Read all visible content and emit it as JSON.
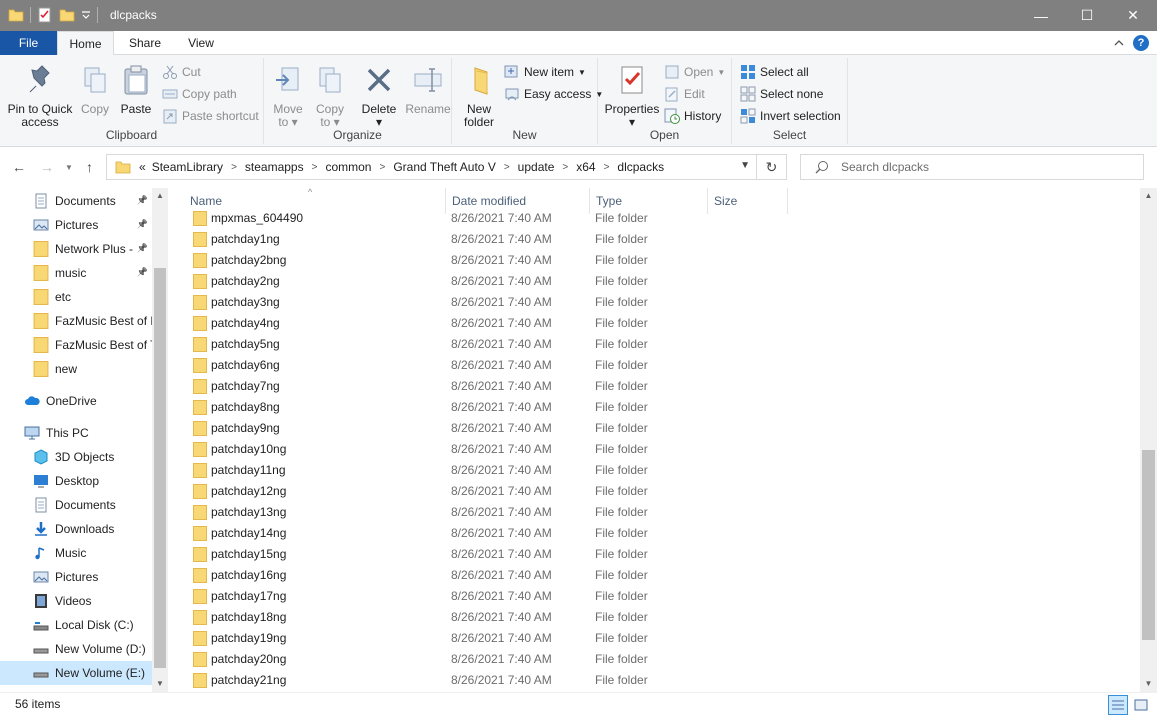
{
  "window": {
    "title": "dlcpacks",
    "minimize": "—",
    "maximize": "☐",
    "close": "✕"
  },
  "tabs": {
    "file": "File",
    "home": "Home",
    "share": "Share",
    "view": "View"
  },
  "ribbon": {
    "clipboard": {
      "label": "Clipboard",
      "pin": "Pin to Quick access",
      "copy": "Copy",
      "paste": "Paste",
      "cut": "Cut",
      "copy_path": "Copy path",
      "paste_shortcut": "Paste shortcut"
    },
    "organize": {
      "label": "Organize",
      "move_to": "Move to",
      "copy_to": "Copy to",
      "delete": "Delete",
      "rename": "Rename"
    },
    "new": {
      "label": "New",
      "new_folder": "New folder",
      "new_item": "New item",
      "easy_access": "Easy access"
    },
    "open": {
      "label": "Open",
      "properties": "Properties",
      "open": "Open",
      "edit": "Edit",
      "history": "History"
    },
    "select": {
      "label": "Select",
      "select_all": "Select all",
      "select_none": "Select none",
      "invert": "Invert selection"
    }
  },
  "address": {
    "prefix": "«",
    "crumbs": [
      "SteamLibrary",
      "steamapps",
      "common",
      "Grand Theft Auto V",
      "update",
      "x64",
      "dlcpacks"
    ]
  },
  "search": {
    "placeholder": "Search dlcpacks"
  },
  "nav": {
    "quick": [
      {
        "label": "Documents",
        "pinned": true
      },
      {
        "label": "Pictures",
        "pinned": true
      },
      {
        "label": "Network Plus -",
        "pinned": true
      },
      {
        "label": "music",
        "pinned": true
      },
      {
        "label": "etc"
      },
      {
        "label": "FazMusic Best of M"
      },
      {
        "label": "FazMusic Best of T"
      },
      {
        "label": "new"
      }
    ],
    "onedrive": "OneDrive",
    "thispc": "This PC",
    "pc_items": [
      "3D Objects",
      "Desktop",
      "Documents",
      "Downloads",
      "Music",
      "Pictures",
      "Videos",
      "Local Disk (C:)",
      "New Volume (D:)",
      "New Volume (E:)"
    ]
  },
  "columns": {
    "name": "Name",
    "date": "Date modified",
    "type": "Type",
    "size": "Size"
  },
  "files": [
    {
      "name": "mpxmas_604490",
      "date": "8/26/2021 7:40 AM",
      "type": "File folder"
    },
    {
      "name": "patchday1ng",
      "date": "8/26/2021 7:40 AM",
      "type": "File folder"
    },
    {
      "name": "patchday2bng",
      "date": "8/26/2021 7:40 AM",
      "type": "File folder"
    },
    {
      "name": "patchday2ng",
      "date": "8/26/2021 7:40 AM",
      "type": "File folder"
    },
    {
      "name": "patchday3ng",
      "date": "8/26/2021 7:40 AM",
      "type": "File folder"
    },
    {
      "name": "patchday4ng",
      "date": "8/26/2021 7:40 AM",
      "type": "File folder"
    },
    {
      "name": "patchday5ng",
      "date": "8/26/2021 7:40 AM",
      "type": "File folder"
    },
    {
      "name": "patchday6ng",
      "date": "8/26/2021 7:40 AM",
      "type": "File folder"
    },
    {
      "name": "patchday7ng",
      "date": "8/26/2021 7:40 AM",
      "type": "File folder"
    },
    {
      "name": "patchday8ng",
      "date": "8/26/2021 7:40 AM",
      "type": "File folder"
    },
    {
      "name": "patchday9ng",
      "date": "8/26/2021 7:40 AM",
      "type": "File folder"
    },
    {
      "name": "patchday10ng",
      "date": "8/26/2021 7:40 AM",
      "type": "File folder"
    },
    {
      "name": "patchday11ng",
      "date": "8/26/2021 7:40 AM",
      "type": "File folder"
    },
    {
      "name": "patchday12ng",
      "date": "8/26/2021 7:40 AM",
      "type": "File folder"
    },
    {
      "name": "patchday13ng",
      "date": "8/26/2021 7:40 AM",
      "type": "File folder"
    },
    {
      "name": "patchday14ng",
      "date": "8/26/2021 7:40 AM",
      "type": "File folder"
    },
    {
      "name": "patchday15ng",
      "date": "8/26/2021 7:40 AM",
      "type": "File folder"
    },
    {
      "name": "patchday16ng",
      "date": "8/26/2021 7:40 AM",
      "type": "File folder"
    },
    {
      "name": "patchday17ng",
      "date": "8/26/2021 7:40 AM",
      "type": "File folder"
    },
    {
      "name": "patchday18ng",
      "date": "8/26/2021 7:40 AM",
      "type": "File folder"
    },
    {
      "name": "patchday19ng",
      "date": "8/26/2021 7:40 AM",
      "type": "File folder"
    },
    {
      "name": "patchday20ng",
      "date": "8/26/2021 7:40 AM",
      "type": "File folder"
    },
    {
      "name": "patchday21ng",
      "date": "8/26/2021 7:40 AM",
      "type": "File folder"
    }
  ],
  "status": {
    "count": "56 items"
  },
  "colors": {
    "folder": "#f8d775",
    "folder_dark": "#e5b84b",
    "accent": "#1a56a6",
    "selected": "#cce8ff"
  }
}
